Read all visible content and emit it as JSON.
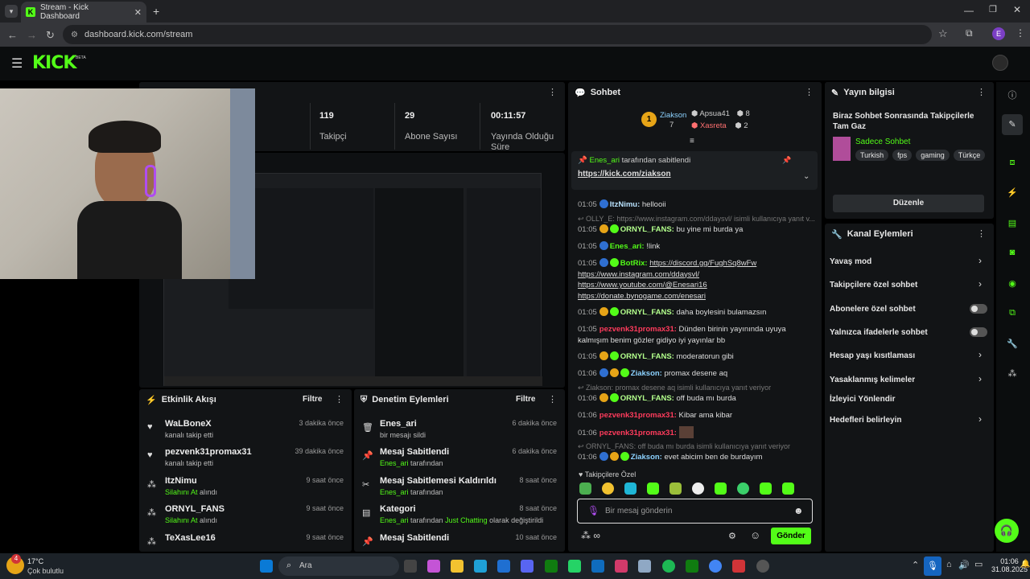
{
  "browser": {
    "tab_title": "Stream - Kick Dashboard",
    "url": "dashboard.kick.com/stream",
    "profile_initial": "E"
  },
  "brand": {
    "logo": "KICK",
    "beta": "BETA"
  },
  "stats": [
    {
      "value": "119",
      "label": "Takipçi"
    },
    {
      "value": "29",
      "label": "Abone Sayısı"
    },
    {
      "value": "00:11:57",
      "label": "Yayında Olduğu Süre"
    }
  ],
  "activity": {
    "title": "Etkinlik Akışı",
    "filter": "Filtre",
    "items": [
      {
        "name": "WaLBoneX",
        "sub": "kanalı takip etti",
        "time": "3 dakika önce",
        "sub_green": false
      },
      {
        "name": "pezvenk31promax31",
        "sub": "kanalı takip etti",
        "time": "39 dakika önce",
        "sub_green": false
      },
      {
        "name": "ItzNimu",
        "sub": "Silahını At",
        "sub2": " alındı",
        "time": "9 saat önce",
        "sub_green": true
      },
      {
        "name": "ORNYL_FANS",
        "sub": "Silahını At",
        "sub2": " alındı",
        "time": "9 saat önce",
        "sub_green": true
      },
      {
        "name": "TeXasLee16",
        "sub": "Silahını At",
        "sub2": " alındı",
        "time": "9 saat önce",
        "sub_green": true
      }
    ]
  },
  "moderation": {
    "title": "Denetim Eylemleri",
    "filter": "Filtre",
    "items": [
      {
        "name": "Enes_ari",
        "sub": "bir mesajı sildi",
        "time": "6 dakika önce"
      },
      {
        "name": "Mesaj Sabitlendi",
        "sub": "Enes_ari",
        "sub2": " tarafından",
        "time": "6 dakika önce"
      },
      {
        "name": "Mesaj Sabitlemesi Kaldırıldı",
        "sub": "Enes_ari",
        "sub2": " tarafından",
        "time": "8 saat önce"
      },
      {
        "name": "Kategori",
        "sub": "Enes_ari",
        "sub2": " tarafından ",
        "sub3": "Just Chatting",
        "sub4": " olarak değiştirildi",
        "time": "8 saat önce"
      },
      {
        "name": "Mesaj Sabitlendi",
        "sub": "Enes_ari",
        "sub2": " tarafından",
        "time": "10 saat önce"
      }
    ]
  },
  "chat": {
    "title": "Sohbet",
    "leader1": {
      "name": "Ziakson",
      "count": "7"
    },
    "leader2": {
      "name": "Apsua41",
      "count": "8"
    },
    "leader3": {
      "name": "Xasreta",
      "count": "2"
    },
    "pinned_by": "Enes_ari",
    "pinned_suffix": " tarafından sabitlendi",
    "pinned_link": "https://kick.com/ziakson",
    "messages": [
      {
        "time": "01:05",
        "user": "ItzNimu:",
        "text": " hellooii",
        "color": "#b9e3ff"
      },
      {
        "reply": "OLLY_E: https://www.instagram.com/ddaysvl/ isimli kullanıcıya yanıt v..."
      },
      {
        "time": "01:05",
        "user": "ORNYL_FANS:",
        "text": " bu yine mi burda ya",
        "color": "#b3ff8c"
      },
      {
        "time": "01:05",
        "user": "Enes_ari:",
        "text": " !link",
        "color": "#53fc18"
      },
      {
        "time": "01:05",
        "user": "BotRix:",
        "text": " ",
        "link": "https://discord.gg/FughSq8wFw",
        "color": "#53fc18"
      },
      {
        "time": "01:05",
        "user": "ORNYL_FANS:",
        "text": " daha boylesini bulamazsın",
        "color": "#b3ff8c"
      },
      {
        "time": "01:05",
        "user": "pezvenk31promax31:",
        "text": " Dünden birinin yayınında uyuya kalmışım benim gözler gidiyo iyi yayınlar bb",
        "color": "#ff3b5c"
      },
      {
        "time": "01:05",
        "user": "ORNYL_FANS:",
        "text": " moderatorun gibi",
        "color": "#b3ff8c"
      },
      {
        "time": "01:06",
        "user": "Ziakson:",
        "text": " promax desene aq",
        "color": "#8cd2ff"
      },
      {
        "reply": "Ziakson: promax desene aq isimli kullanıcıya yanıt veriyor"
      },
      {
        "time": "01:06",
        "user": "ORNYL_FANS:",
        "text": " off buda mı burda",
        "color": "#b3ff8c"
      },
      {
        "time": "01:06",
        "user": "pezvenk31promax31:",
        "text": " Kibar ama kibar",
        "color": "#ff3b5c"
      },
      {
        "time": "01:06",
        "user": "pezvenk31promax31:",
        "text": "",
        "color": "#ff3b5c"
      },
      {
        "reply": "ORNYL_FANS: off buda mı burda isimli kullanıcıya yanıt veriyor"
      },
      {
        "time": "01:06",
        "user": "Ziakson:",
        "text": " evet abicim ben de burdayım",
        "color": "#8cd2ff"
      }
    ],
    "botrix_links": [
      "https://www.instagram.com/ddaysvl/",
      "https://www.youtube.com/@Enesari16",
      "https://donate.bynogame.com/enesari"
    ],
    "emote_header": "Takipçilere Özel",
    "input_placeholder": "Bir mesaj gönderin",
    "send": "Gönder"
  },
  "info": {
    "title": "Yayın bilgisi",
    "stream_title": "Biraz Sohbet Sonrasında Takipçilerle Tam Gaz",
    "category": "Sadece Sohbet",
    "tags": [
      "Turkish",
      "fps",
      "gaming",
      "Türkçe"
    ],
    "edit": "Düzenle"
  },
  "channel": {
    "title": "Kanal Eylemleri",
    "actions": [
      "Yavaş mod",
      "Takipçilere özel sohbet",
      "Abonelere özel sohbet",
      "Yalnızca ifadelerle sohbet",
      "Hesap yaşı kısıtlaması",
      "Yasaklanmış kelimeler",
      "İzleyici Yönlendir",
      "Hedefleri belirleyin"
    ]
  },
  "taskbar": {
    "temp": "17°C",
    "weather": "Çok bulutlu",
    "search": "Ara",
    "time": "01:06",
    "date": "31.08.2025",
    "notif": "4"
  }
}
